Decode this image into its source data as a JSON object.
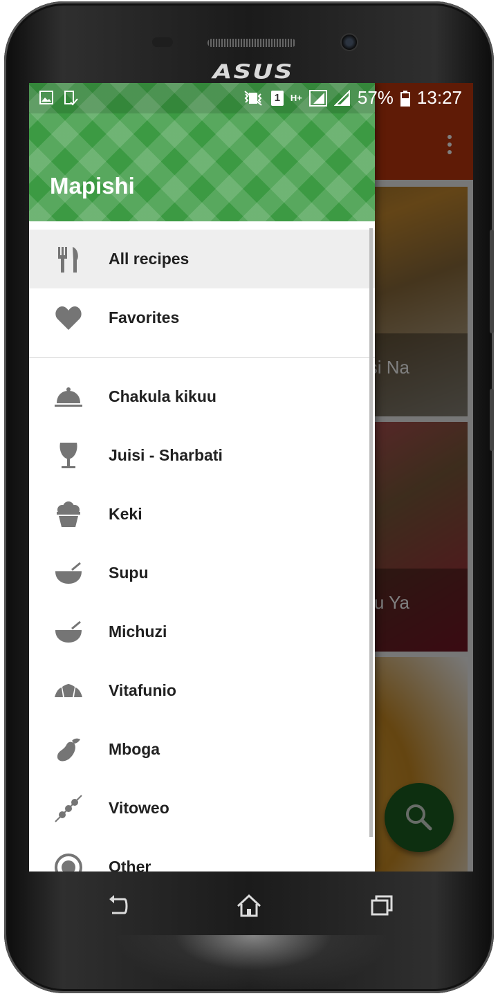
{
  "status_bar": {
    "battery": "57%",
    "time": "13:27",
    "sim_slot": "1",
    "network_type": "H+"
  },
  "drawer": {
    "title": "Mapishi",
    "primary_items": [
      {
        "label": "All recipes",
        "icon": "fork-knife-icon",
        "active": true
      },
      {
        "label": "Favorites",
        "icon": "heart-icon"
      }
    ],
    "category_items": [
      {
        "label": "Chakula kikuu",
        "icon": "cloche-icon"
      },
      {
        "label": "Juisi - Sharbati",
        "icon": "wine-glass-icon"
      },
      {
        "label": "Keki",
        "icon": "cupcake-icon"
      },
      {
        "label": "Supu",
        "icon": "soup-bowl-icon"
      },
      {
        "label": "Michuzi",
        "icon": "soup-bowl-icon"
      },
      {
        "label": "Vitafunio",
        "icon": "croissant-icon"
      },
      {
        "label": "Mboga",
        "icon": "eggplant-icon"
      },
      {
        "label": "Vitoweo",
        "icon": "kebab-icon"
      },
      {
        "label": "Other",
        "icon": "plate-icon"
      }
    ]
  },
  "background": {
    "cards": [
      {
        "title": "asi Na"
      },
      {
        "title": "avu Ya"
      },
      {
        "title": ""
      }
    ]
  },
  "device": {
    "brand": "ASUS"
  },
  "colors": {
    "drawer_header": "#3c9a43",
    "app_bar": "#bf360c",
    "fab": "#1b5e20",
    "icon_gray": "#757575"
  }
}
